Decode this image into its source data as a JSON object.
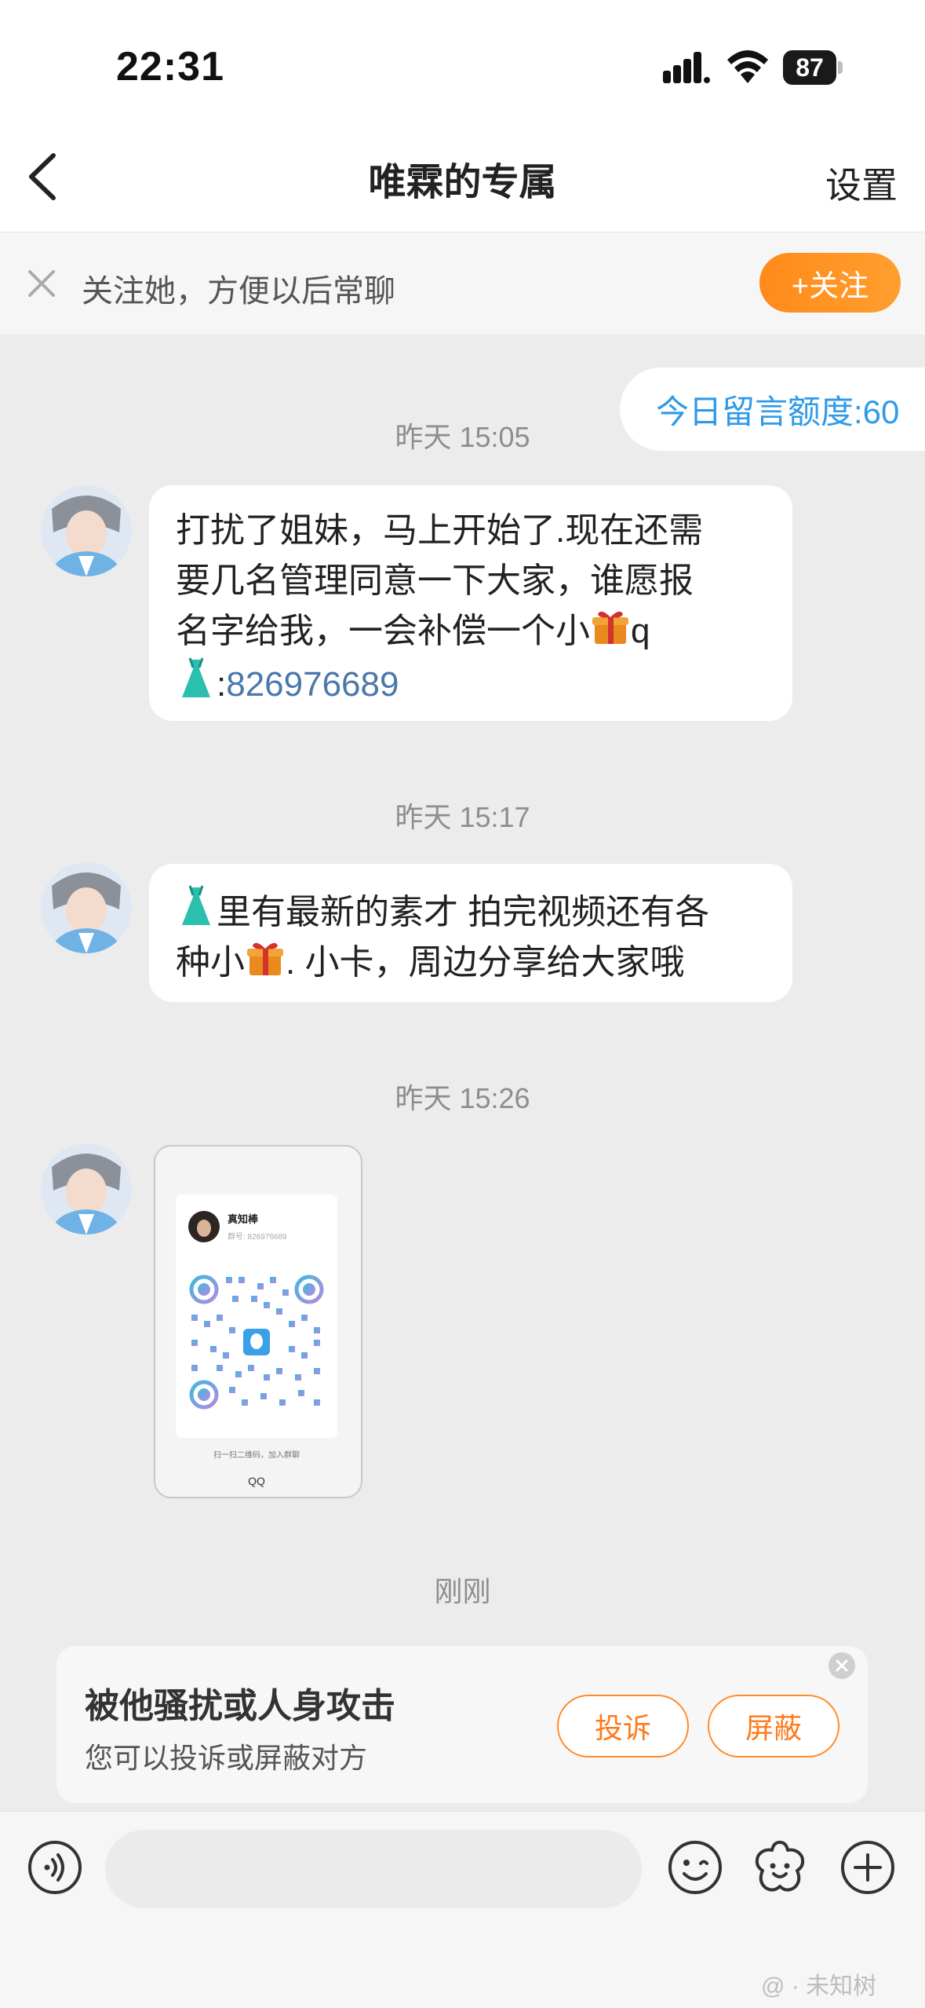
{
  "status_bar": {
    "time": "22:31",
    "battery": "87"
  },
  "nav": {
    "title": "唯霖的专属",
    "settings_label": "设置"
  },
  "follow_bar": {
    "text": "关注她，方便以后常聊",
    "button_label": "+关注"
  },
  "quota_label": "今日留言额度:60",
  "messages": [
    {
      "timestamp": "昨天 15:05",
      "line1": "打扰了姐妹，马上开始了.现在还需",
      "line2": "要几名管理同意一下大家，谁愿报",
      "line3_pre": "名字给我，一会补偿一个小",
      "line3_post": "q",
      "line4_pre": ":",
      "qq_number": "826976689"
    },
    {
      "timestamp": "昨天 15:17",
      "line1_post": "里有最新的素才 拍完视频还有各",
      "line2_pre": "种小",
      "line2_post": ". 小卡，周边分享给大家哦"
    },
    {
      "timestamp": "昨天 15:26",
      "qr_card": {
        "name": "真知棒",
        "id_line": "群号: 826976689",
        "hint": "扫一扫二维码，加入群聊",
        "footer": "QQ"
      }
    }
  ],
  "recent_timestamp": "刚刚",
  "report_card": {
    "title": "被他骚扰或人身攻击",
    "subtitle": "您可以投诉或屏蔽对方",
    "complain_label": "投诉",
    "block_label": "屏蔽"
  },
  "input": {
    "placeholder": ""
  },
  "watermark": "@ · 未知树",
  "colors": {
    "accent_orange": "#ff8a1a",
    "link_blue": "#2f9ae8",
    "qq_number_blue": "#4a78a8"
  },
  "icons": [
    "back-icon",
    "close-icon",
    "voice-icon",
    "emoji-icon",
    "sticker-icon",
    "plus-icon",
    "gift-emoji",
    "dress-emoji",
    "signal-icon",
    "wifi-icon",
    "battery-icon"
  ]
}
